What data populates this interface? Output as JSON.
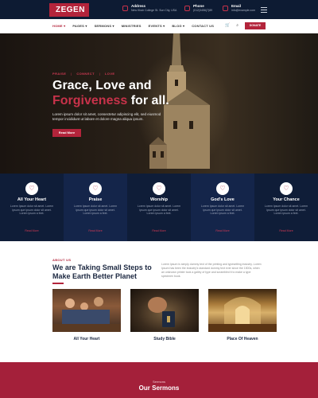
{
  "brand": {
    "name": "ZEGEN",
    "accent": "#b3243b",
    "dark": "#0d1b33"
  },
  "topbar": {
    "address": {
      "label": "Address",
      "value": "New Khair College St. Sun City, USA"
    },
    "phone": {
      "label": "Phone",
      "value": "(012)3456(7)89"
    },
    "email": {
      "label": "Email",
      "value": "info@example.com"
    }
  },
  "nav": {
    "items": [
      "HOME ▾",
      "PAGES ▾",
      "SERMONS ▾",
      "MINISTRIES",
      "EVENTS ▾",
      "BLOG ▾",
      "CONTACT US"
    ],
    "donate_label": "DONATE",
    "cart_icon": "cart-icon",
    "search_icon": "search-icon"
  },
  "hero": {
    "tags": [
      "PRAISE",
      "CONNECT",
      "LOVE"
    ],
    "title_line1": "Grace, Love and",
    "title_highlight": "Forgiveness",
    "title_rest": " for all.",
    "text": "Lorem ipsum dolor sit amet, consectetur adipiscing elit, sed eiusmod tempor incididunt ut labore et dolore magna aliqua ipsum.",
    "button_label": "Read More"
  },
  "features": [
    {
      "title": "All Your Heart",
      "text": "Lorem Ipsum dolor sit amet. Lorem ipsum que ipsum dolor sit amet. Lorem ipsum a feet.",
      "more": "Read More",
      "icon": "heart-icon"
    },
    {
      "title": "Praise",
      "text": "Lorem Ipsum dolor sit amet. Lorem ipsum que ipsum dolor sit amet. Lorem ipsum a feet.",
      "more": "Read More",
      "icon": "heart-icon"
    },
    {
      "title": "Worship",
      "text": "Lorem Ipsum dolor sit amet. Lorem ipsum que ipsum dolor sit amet. Lorem ipsum a feet.",
      "more": "Read More",
      "icon": "heart-icon"
    },
    {
      "title": "God's Love",
      "text": "Lorem Ipsum dolor sit amet. Lorem ipsum que ipsum dolor sit amet. Lorem ipsum a feet.",
      "more": "Read More",
      "icon": "heart-icon"
    },
    {
      "title": "Your Chance",
      "text": "Lorem Ipsum dolor sit amet. Lorem ipsum que ipsum dolor sit amet. Lorem ipsum a feet.",
      "more": "Read More",
      "icon": "heart-icon"
    }
  ],
  "about": {
    "tag": "ABOUT US",
    "title": "We are Taking Small Steps to Make Earth Better Planet",
    "text": "Lorem Ipsum is simply dummy text of the printing and typesetting industry. Lorem Ipsum has been the industry's standard dummy text ever since the 1500s, when an unknown printer took a galley of type and scrambled it to make a type specimen book.",
    "cards": [
      {
        "caption": "All Your Heart"
      },
      {
        "caption": "Study Bible"
      },
      {
        "caption": "Place Of Heaven"
      }
    ]
  },
  "sermons": {
    "tag": "Sermons",
    "title": "Our Sermons"
  }
}
